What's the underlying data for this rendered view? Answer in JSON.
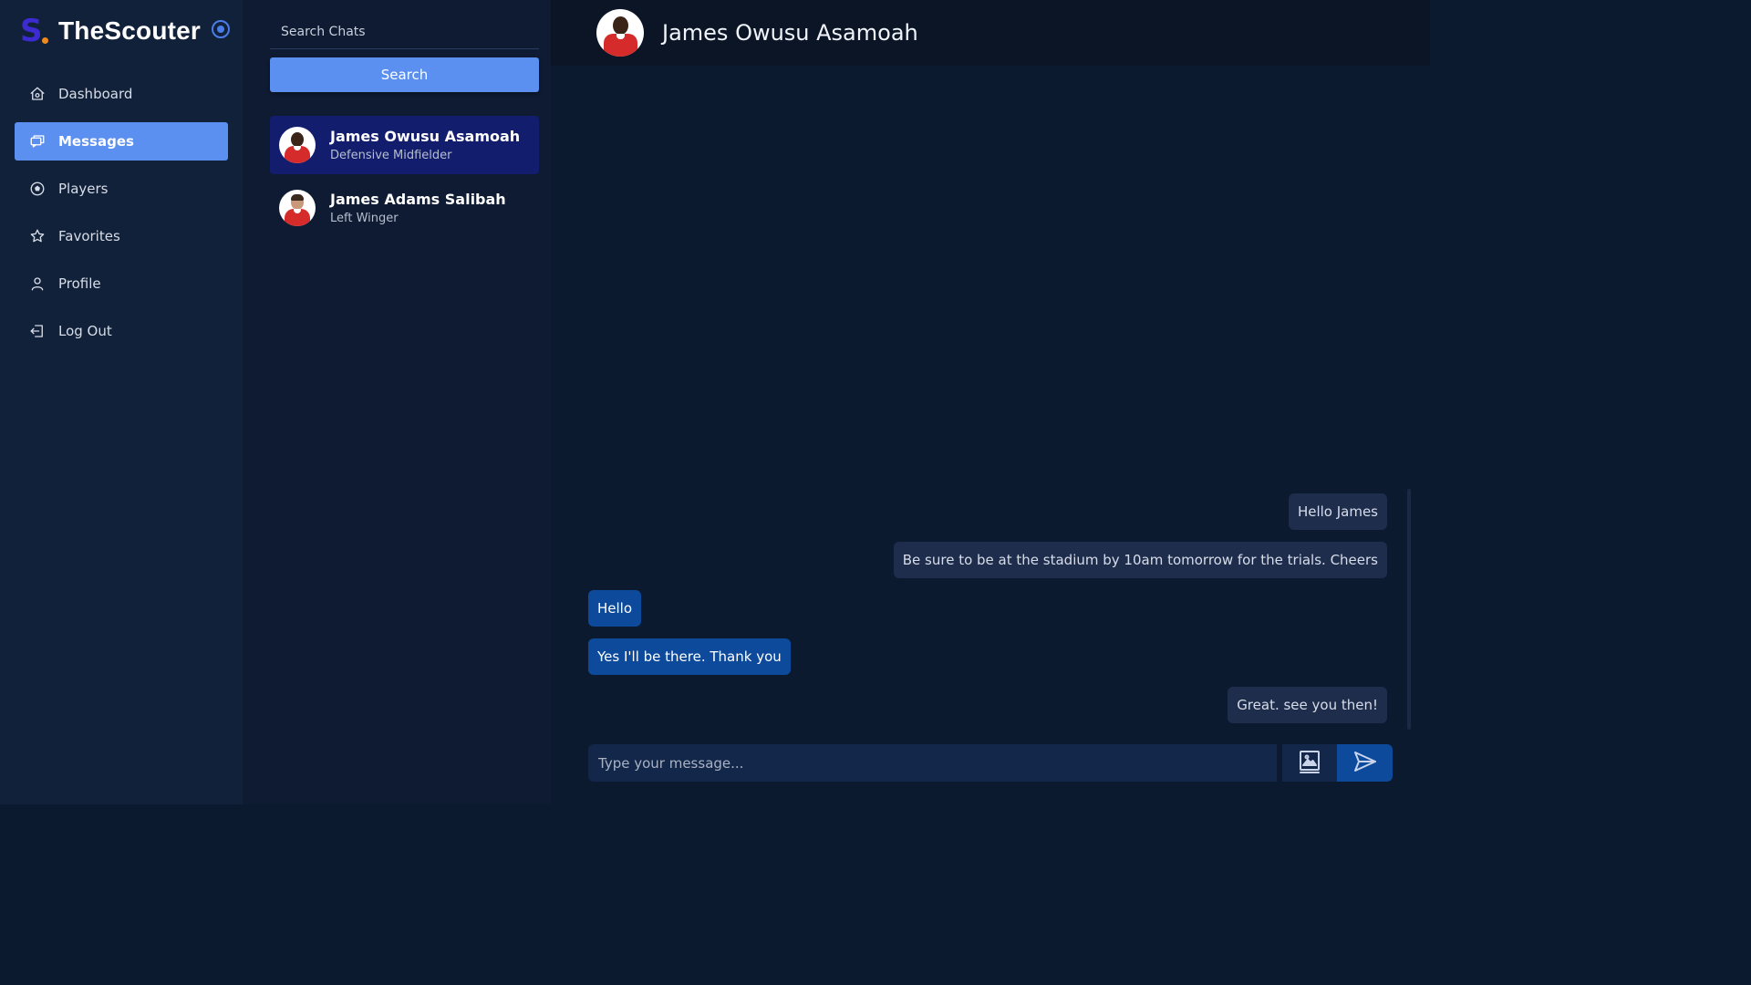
{
  "brand": {
    "logo_letter": "S",
    "name": "TheScouter"
  },
  "sidebar": {
    "items": [
      {
        "label": "Dashboard",
        "icon": "home-icon"
      },
      {
        "label": "Messages",
        "icon": "chat-icon",
        "active": true
      },
      {
        "label": "Players",
        "icon": "soccer-ball-icon"
      },
      {
        "label": "Favorites",
        "icon": "star-icon"
      },
      {
        "label": "Profile",
        "icon": "user-icon"
      },
      {
        "label": "Log Out",
        "icon": "logout-icon"
      }
    ]
  },
  "chatlist": {
    "search_placeholder": "Search Chats",
    "search_button": "Search",
    "contacts": [
      {
        "name": "James Owusu Asamoah",
        "role": "Defensive Midfielder",
        "active": true
      },
      {
        "name": "James Adams Salibah",
        "role": "Left Winger",
        "active": false
      }
    ]
  },
  "chat": {
    "title": "James Owusu Asamoah",
    "messages": [
      {
        "text": "Hello James",
        "direction": "outgoing"
      },
      {
        "text": "Be sure to be at the stadium by 10am tomorrow for the trials. Cheers",
        "direction": "outgoing"
      },
      {
        "text": "Hello",
        "direction": "incoming"
      },
      {
        "text": "Yes I'll be there. Thank you",
        "direction": "incoming"
      },
      {
        "text": "Great. see you then!",
        "direction": "outgoing"
      }
    ],
    "input_placeholder": "Type your message..."
  },
  "colors": {
    "background": "#0c1a30",
    "sidebar": "#12213a",
    "accent": "#5b8ff0",
    "active_contact": "#121d6e",
    "incoming_bubble": "#0d4a9c",
    "outgoing_bubble": "#1f2d4d",
    "logo_s": "#3b2bd0",
    "logo_dot": "#f08a1e"
  }
}
